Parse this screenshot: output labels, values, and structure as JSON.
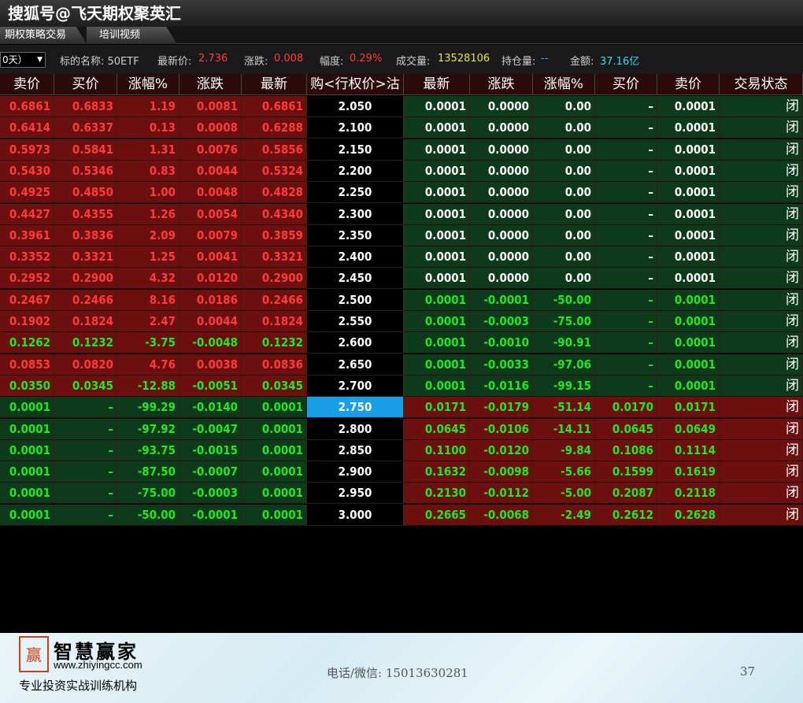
{
  "window": {
    "title": "搜狐号@飞天期权聚英汇"
  },
  "tabs": [
    {
      "label": "期权策略交易"
    },
    {
      "label": "培训视频"
    }
  ],
  "toolbar": {
    "period_select": "0天）",
    "underlying_label": "标的名称: 50ETF",
    "last_price_label": "最新价:",
    "last_price": "2.736",
    "change_label": "涨跌:",
    "change": "0.008",
    "range_label": "幅度:",
    "range": "0.29%",
    "volume_label": "成交量:",
    "volume": "13528106",
    "open_interest_label": "持仓量:",
    "open_interest": "--",
    "amount_label": "金额:",
    "amount": "37.16亿"
  },
  "colors": {
    "call_itm": "#6b0f0f",
    "call_otm": "#0d3a1a",
    "put_otm": "#0d3a1a",
    "put_itm": "#6b0f0f",
    "selected_strike": "#1a9fe6"
  },
  "table": {
    "headers": [
      "卖价",
      "买价",
      "涨幅%",
      "涨跌",
      "最新",
      "购<行权价>沽↑",
      "最新",
      "涨跌",
      "涨幅%",
      "买价",
      "卖价",
      "交易状态"
    ],
    "rows": [
      {
        "call": [
          "0.6861",
          "0.6833",
          "1.19",
          "0.0081",
          "0.6861"
        ],
        "call_color": "red",
        "call_bg": "itm",
        "strike": "2.050",
        "put": [
          "0.0001",
          "0.0000",
          "0.00",
          "–",
          "0.0001"
        ],
        "put_color": "white",
        "put_bg": "otm",
        "status": "闭"
      },
      {
        "call": [
          "0.6414",
          "0.6337",
          "0.13",
          "0.0008",
          "0.6288"
        ],
        "call_color": "red",
        "call_bg": "itm",
        "strike": "2.100",
        "put": [
          "0.0001",
          "0.0000",
          "0.00",
          "–",
          "0.0001"
        ],
        "put_color": "white",
        "put_bg": "otm",
        "status": "闭"
      },
      {
        "call": [
          "0.5973",
          "0.5841",
          "1.31",
          "0.0076",
          "0.5856"
        ],
        "call_color": "red",
        "call_bg": "itm",
        "strike": "2.150",
        "put": [
          "0.0001",
          "0.0000",
          "0.00",
          "–",
          "0.0001"
        ],
        "put_color": "white",
        "put_bg": "otm",
        "status": "闭"
      },
      {
        "call": [
          "0.5430",
          "0.5346",
          "0.83",
          "0.0044",
          "0.5324"
        ],
        "call_color": "red",
        "call_bg": "itm",
        "strike": "2.200",
        "put": [
          "0.0001",
          "0.0000",
          "0.00",
          "–",
          "0.0001"
        ],
        "put_color": "white",
        "put_bg": "otm",
        "status": "闭"
      },
      {
        "call": [
          "0.4925",
          "0.4850",
          "1.00",
          "0.0048",
          "0.4828"
        ],
        "call_color": "red",
        "call_bg": "itm",
        "strike": "2.250",
        "put": [
          "0.0001",
          "0.0000",
          "0.00",
          "–",
          "0.0001"
        ],
        "put_color": "white",
        "put_bg": "otm",
        "status": "闭"
      },
      {
        "call": [
          "0.4427",
          "0.4355",
          "1.26",
          "0.0054",
          "0.4340"
        ],
        "call_color": "red",
        "call_bg": "itm",
        "strike": "2.300",
        "put": [
          "0.0001",
          "0.0000",
          "0.00",
          "–",
          "0.0001"
        ],
        "put_color": "white",
        "put_bg": "otm",
        "status": "闭"
      },
      {
        "call": [
          "0.3961",
          "0.3836",
          "2.09",
          "0.0079",
          "0.3859"
        ],
        "call_color": "red",
        "call_bg": "itm",
        "strike": "2.350",
        "put": [
          "0.0001",
          "0.0000",
          "0.00",
          "–",
          "0.0001"
        ],
        "put_color": "white",
        "put_bg": "otm",
        "status": "闭"
      },
      {
        "call": [
          "0.3352",
          "0.3321",
          "1.25",
          "0.0041",
          "0.3321"
        ],
        "call_color": "red",
        "call_bg": "itm",
        "strike": "2.400",
        "put": [
          "0.0001",
          "0.0000",
          "0.00",
          "–",
          "0.0001"
        ],
        "put_color": "white",
        "put_bg": "otm",
        "status": "闭"
      },
      {
        "call": [
          "0.2952",
          "0.2900",
          "4.32",
          "0.0120",
          "0.2900"
        ],
        "call_color": "red",
        "call_bg": "itm",
        "strike": "2.450",
        "put": [
          "0.0001",
          "0.0000",
          "0.00",
          "–",
          "0.0001"
        ],
        "put_color": "white",
        "put_bg": "otm",
        "status": "闭"
      },
      {
        "call": [
          "0.2467",
          "0.2466",
          "8.16",
          "0.0186",
          "0.2466"
        ],
        "call_color": "red",
        "call_bg": "itm",
        "strike": "2.500",
        "put": [
          "0.0001",
          "-0.0001",
          "-50.00",
          "–",
          "0.0001"
        ],
        "put_color": "green",
        "put_bg": "otm",
        "status": "闭"
      },
      {
        "call": [
          "0.1902",
          "0.1824",
          "2.47",
          "0.0044",
          "0.1824"
        ],
        "call_color": "red",
        "call_bg": "itm",
        "strike": "2.550",
        "put": [
          "0.0001",
          "-0.0003",
          "-75.00",
          "–",
          "0.0001"
        ],
        "put_color": "green",
        "put_bg": "otm",
        "status": "闭"
      },
      {
        "call": [
          "0.1262",
          "0.1232",
          "-3.75",
          "-0.0048",
          "0.1232"
        ],
        "call_color": "green",
        "call_bg": "itm",
        "strike": "2.600",
        "put": [
          "0.0001",
          "-0.0010",
          "-90.91",
          "–",
          "0.0001"
        ],
        "put_color": "green",
        "put_bg": "otm",
        "status": "闭"
      },
      {
        "call": [
          "0.0853",
          "0.0820",
          "4.76",
          "0.0038",
          "0.0836"
        ],
        "call_color": "red",
        "call_bg": "itm",
        "strike": "2.650",
        "put": [
          "0.0001",
          "-0.0033",
          "-97.06",
          "–",
          "0.0001"
        ],
        "put_color": "green",
        "put_bg": "otm",
        "status": "闭"
      },
      {
        "call": [
          "0.0350",
          "0.0345",
          "-12.88",
          "-0.0051",
          "0.0345"
        ],
        "call_color": "green",
        "call_bg": "itm",
        "strike": "2.700",
        "put": [
          "0.0001",
          "-0.0116",
          "-99.15",
          "–",
          "0.0001"
        ],
        "put_color": "green",
        "put_bg": "otm",
        "status": "闭"
      },
      {
        "call": [
          "0.0001",
          "–",
          "-99.29",
          "-0.0140",
          "0.0001"
        ],
        "call_color": "green",
        "call_bg": "otm",
        "strike": "2.750",
        "put": [
          "0.0171",
          "-0.0179",
          "-51.14",
          "0.0170",
          "0.0171"
        ],
        "put_color": "green",
        "put_bg": "itm",
        "status": "闭",
        "selected": true
      },
      {
        "call": [
          "0.0001",
          "–",
          "-97.92",
          "-0.0047",
          "0.0001"
        ],
        "call_color": "green",
        "call_bg": "otm",
        "strike": "2.800",
        "put": [
          "0.0645",
          "-0.0106",
          "-14.11",
          "0.0645",
          "0.0649"
        ],
        "put_color": "green",
        "put_bg": "itm",
        "status": "闭"
      },
      {
        "call": [
          "0.0001",
          "–",
          "-93.75",
          "-0.0015",
          "0.0001"
        ],
        "call_color": "green",
        "call_bg": "otm",
        "strike": "2.850",
        "put": [
          "0.1100",
          "-0.0120",
          "-9.84",
          "0.1086",
          "0.1114"
        ],
        "put_color": "green",
        "put_bg": "itm",
        "status": "闭"
      },
      {
        "call": [
          "0.0001",
          "–",
          "-87.50",
          "-0.0007",
          "0.0001"
        ],
        "call_color": "green",
        "call_bg": "otm",
        "strike": "2.900",
        "put": [
          "0.1632",
          "-0.0098",
          "-5.66",
          "0.1599",
          "0.1619"
        ],
        "put_color": "green",
        "put_bg": "itm",
        "status": "闭"
      },
      {
        "call": [
          "0.0001",
          "–",
          "-75.00",
          "-0.0003",
          "0.0001"
        ],
        "call_color": "green",
        "call_bg": "otm",
        "strike": "2.950",
        "put": [
          "0.2130",
          "-0.0112",
          "-5.00",
          "0.2087",
          "0.2118"
        ],
        "put_color": "green",
        "put_bg": "itm",
        "status": "闭"
      },
      {
        "call": [
          "0.0001",
          "–",
          "-50.00",
          "-0.0001",
          "0.0001"
        ],
        "call_color": "green",
        "call_bg": "otm",
        "strike": "3.000",
        "put": [
          "0.2665",
          "-0.0068",
          "-2.49",
          "0.2612",
          "0.2628"
        ],
        "put_color": "green",
        "put_bg": "itm",
        "status": "闭"
      }
    ]
  },
  "footer": {
    "logo_char": "赢",
    "brand": "智慧赢家",
    "url": "www.zhiyingcc.com",
    "slogan": "专业投资实战训练机构",
    "contact": "电话/微信: 15013630281",
    "page_number": "37"
  }
}
